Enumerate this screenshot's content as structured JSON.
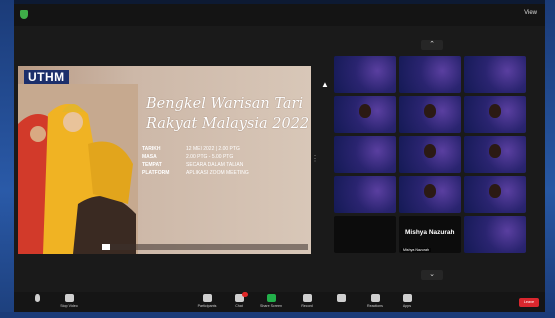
{
  "topbar": {
    "view_label": "View"
  },
  "slide": {
    "logo": "UTHM",
    "title_line1": "Bengkel Warisan Tari",
    "title_line2": "Rakyat Malaysia 2022",
    "info": [
      {
        "key": "TARIKH",
        "value": "12 MEI 2022 | 2.00 PTG"
      },
      {
        "key": "MASA",
        "value": "2.00 PTG - 5.00 PTG"
      },
      {
        "key": "TEMPAT",
        "value": "SECARA DALAM TALIAN"
      },
      {
        "key": "PLATFORM",
        "value": "APLIKASI ZOOM MEETING"
      }
    ],
    "progress_fraction": 0.04
  },
  "gallery": {
    "tiles": [
      {
        "name": "",
        "kind": "purple"
      },
      {
        "name": "",
        "kind": "purple"
      },
      {
        "name": "",
        "kind": "purple"
      },
      {
        "name": "",
        "kind": "face"
      },
      {
        "name": "",
        "kind": "face"
      },
      {
        "name": "",
        "kind": "face"
      },
      {
        "name": "",
        "kind": "purple"
      },
      {
        "name": "",
        "kind": "face"
      },
      {
        "name": "",
        "kind": "face"
      },
      {
        "name": "",
        "kind": "purple"
      },
      {
        "name": "",
        "kind": "face"
      },
      {
        "name": "",
        "kind": "face"
      },
      {
        "name": "",
        "kind": "dark"
      },
      {
        "name": "Mishya Nazurah",
        "kind": "dark",
        "big": "Mishya Nazurah"
      },
      {
        "name": "",
        "kind": "purple"
      }
    ]
  },
  "toolbar": {
    "unmute_label": "",
    "video_label": "Stop Video",
    "participants_label": "Participants",
    "participants_count": "",
    "chat_label": "Chat",
    "chat_badge": "",
    "share_label": "Share Screen",
    "record_label": "Record",
    "cc_label": "",
    "reactions_label": "Reactions",
    "apps_label": "Apps",
    "leave_label": "Leave"
  }
}
